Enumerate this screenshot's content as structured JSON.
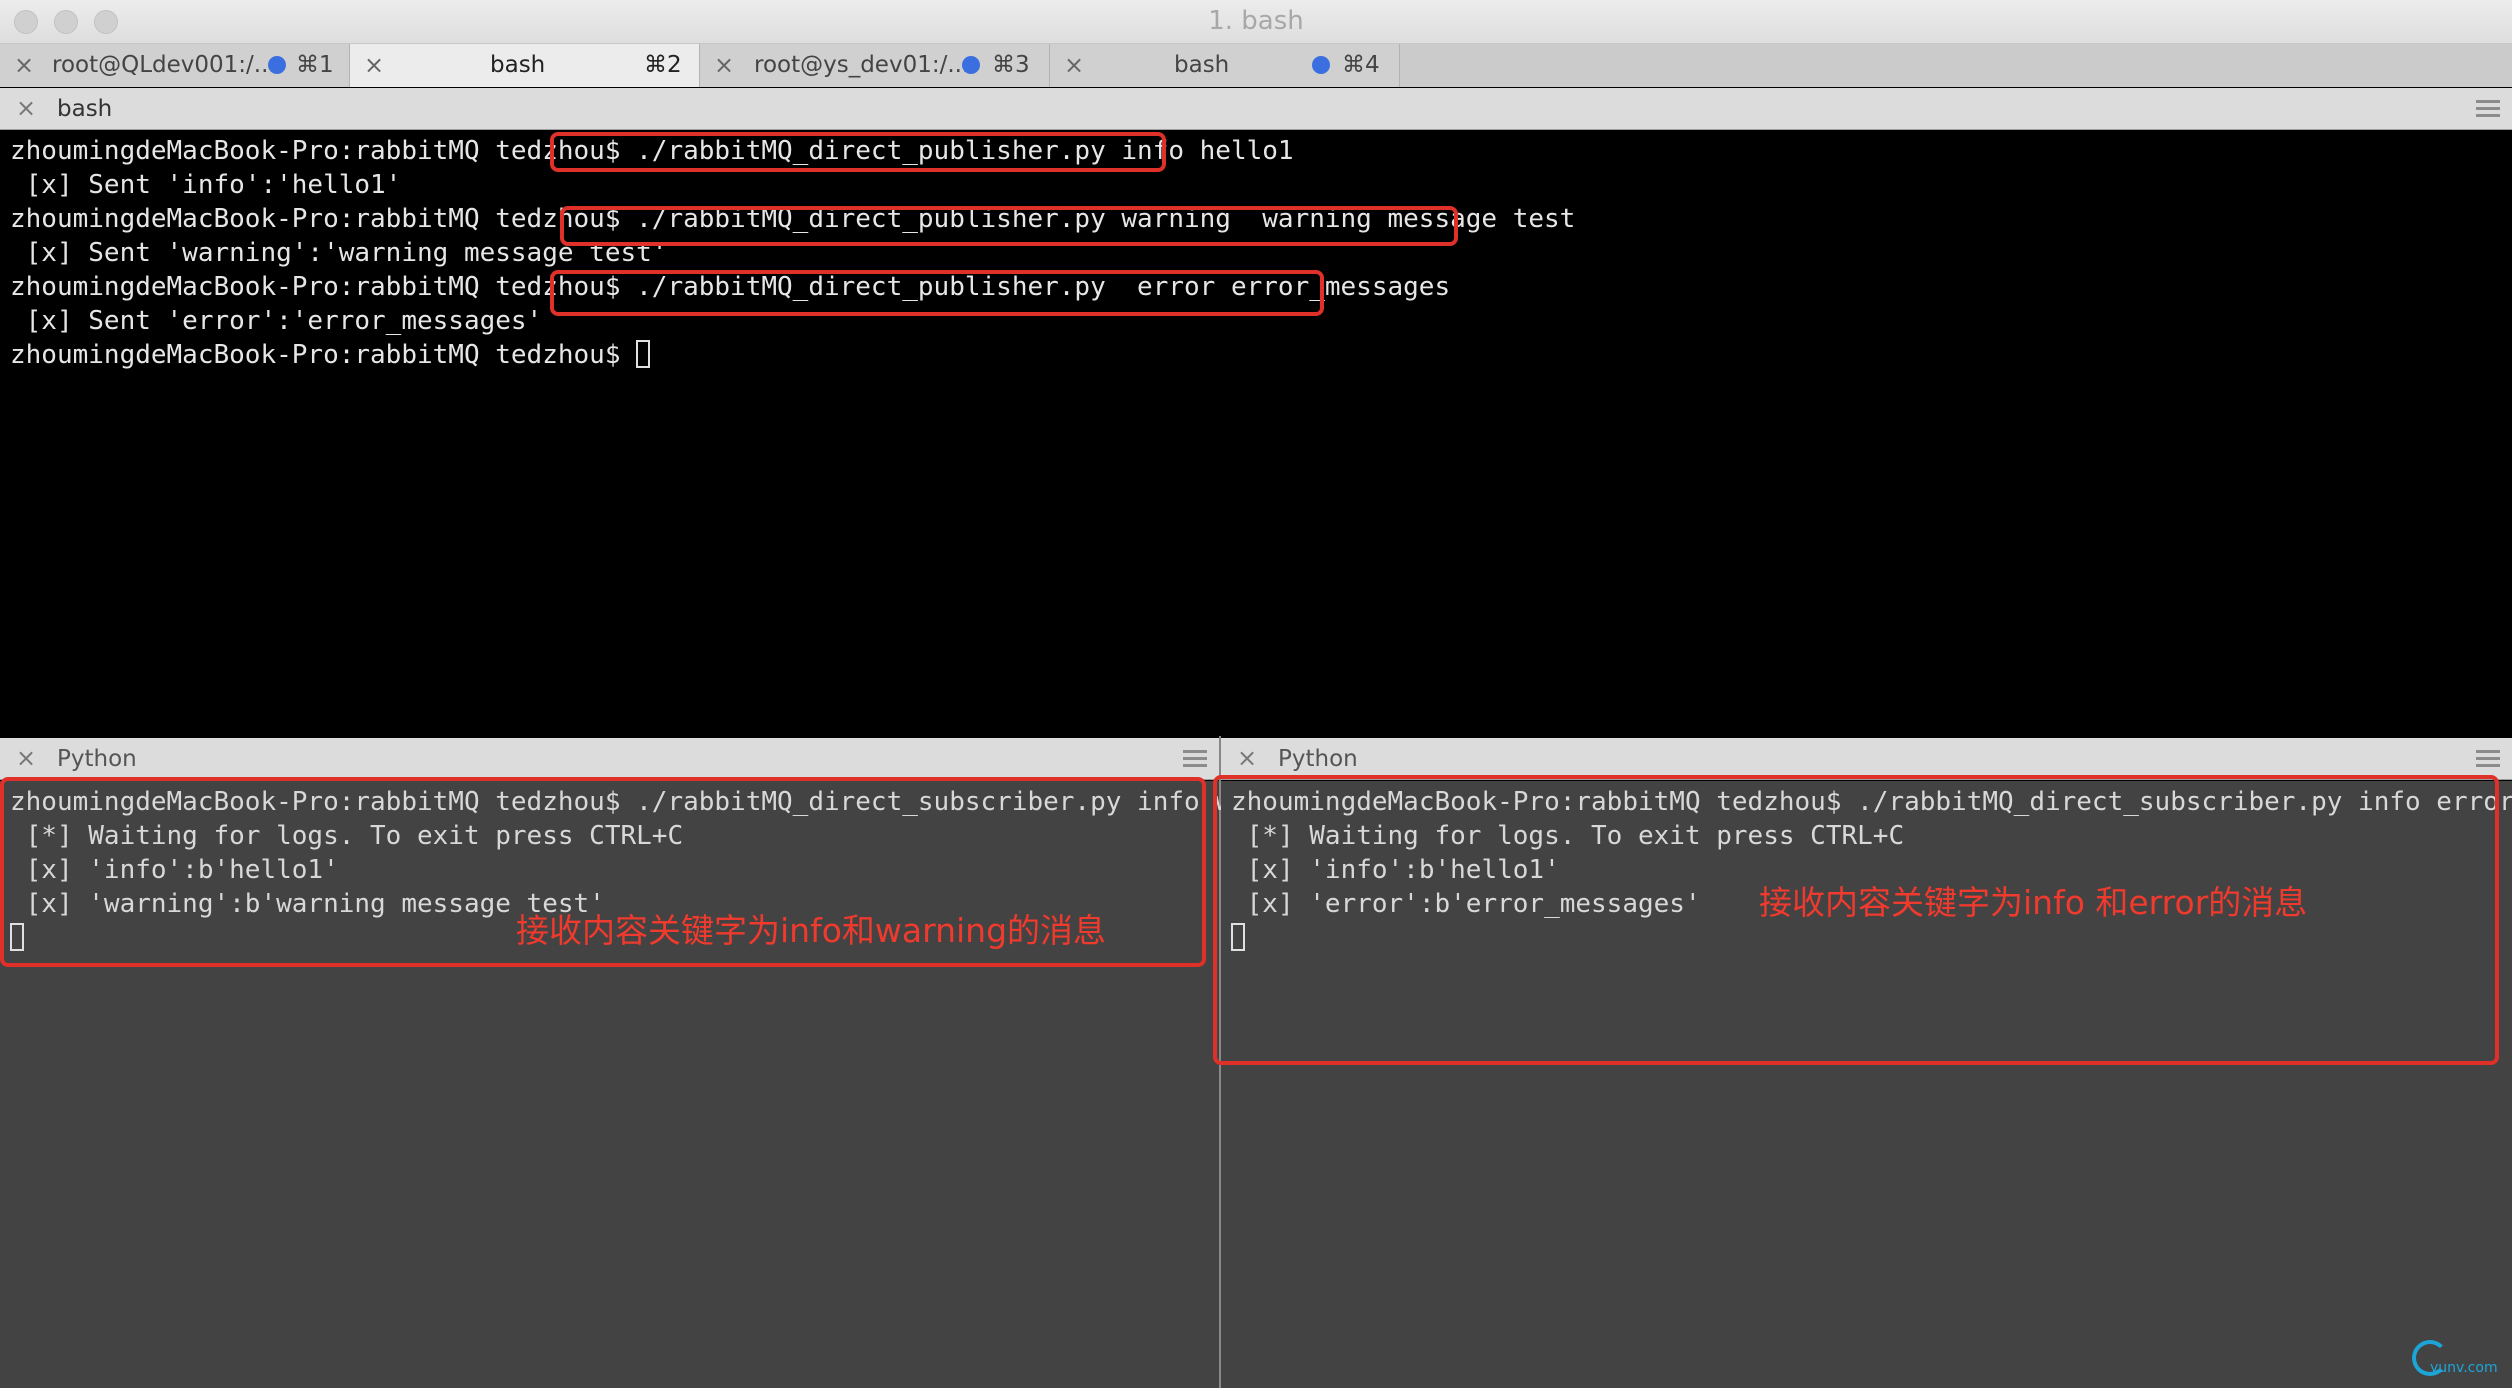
{
  "window": {
    "title": "1. bash"
  },
  "tabs": [
    {
      "label": "root@QLdev001:/...",
      "shortcut": "⌘1",
      "has_dot": true,
      "active": false
    },
    {
      "label": "bash",
      "shortcut": "⌘2",
      "has_dot": false,
      "active": true
    },
    {
      "label": "root@ys_dev01:/...",
      "shortcut": "⌘3",
      "has_dot": true,
      "active": false
    },
    {
      "label": "bash",
      "shortcut": "⌘4",
      "has_dot": true,
      "active": false
    }
  ],
  "panes": {
    "top": {
      "name": "bash",
      "lines": [
        "zhoumingdeMacBook-Pro:rabbitMQ tedzhou$ ./rabbitMQ_direct_publisher.py info hello1",
        " [x] Sent 'info':'hello1'",
        "zhoumingdeMacBook-Pro:rabbitMQ tedzhou$ ./rabbitMQ_direct_publisher.py warning  warning message test",
        " [x] Sent 'warning':'warning message test'",
        "zhoumingdeMacBook-Pro:rabbitMQ tedzhou$ ./rabbitMQ_direct_publisher.py  error error_messages",
        " [x] Sent 'error':'error_messages'",
        "zhoumingdeMacBook-Pro:rabbitMQ tedzhou$ "
      ]
    },
    "bottom_left": {
      "name": "Python",
      "lines": [
        "zhoumingdeMacBook-Pro:rabbitMQ tedzhou$ ./rabbitMQ_direct_subscriber.py info warning",
        " [*] Waiting for logs. To exit press CTRL+C",
        " [x] 'info':b'hello1'",
        " [x] 'warning':b'warning message test'"
      ],
      "note": "接收内容关键字为info和warning的消息"
    },
    "bottom_right": {
      "name": "Python",
      "lines": [
        "zhoumingdeMacBook-Pro:rabbitMQ tedzhou$ ./rabbitMQ_direct_subscriber.py info error",
        " [*] Waiting for logs. To exit press CTRL+C",
        " [x] 'info':b'hello1'",
        " [x] 'error':b'error_messages'"
      ],
      "note": "接收内容关键字为info 和error的消息"
    }
  },
  "icons": {
    "close": "×",
    "menu": "hamburger-icon"
  },
  "colors": {
    "annotation": "#e0302a",
    "tab_dot": "#3b6fe0",
    "watermark": "#1ea5d8"
  },
  "watermark": {
    "text": "yunv.com"
  }
}
